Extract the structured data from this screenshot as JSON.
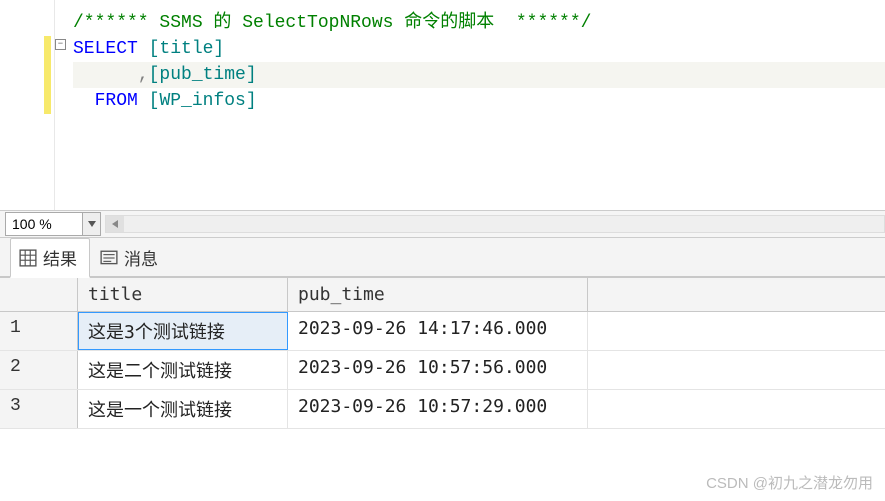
{
  "editor": {
    "comment": "/****** SSMS 的 SelectTopNRows 命令的脚本  ******/",
    "kw_select": "SELECT",
    "col_title": "[title]",
    "comma": ",",
    "col_pub": "[pub_time]",
    "kw_from": "FROM",
    "table": "[WP_infos]",
    "fold_glyph": "−"
  },
  "zoom": {
    "value": "100 %"
  },
  "tabs": {
    "results": "结果",
    "messages": "消息"
  },
  "grid": {
    "headers": {
      "title": "title",
      "pub_time": "pub_time"
    },
    "rows": [
      {
        "num": "1",
        "title": "这是3个测试链接",
        "pub_time": "2023-09-26 14:17:46.000"
      },
      {
        "num": "2",
        "title": "这是二个测试链接",
        "pub_time": "2023-09-26 10:57:56.000"
      },
      {
        "num": "3",
        "title": "这是一个测试链接",
        "pub_time": "2023-09-26 10:57:29.000"
      }
    ]
  },
  "watermark": "CSDN @初九之潜龙勿用"
}
